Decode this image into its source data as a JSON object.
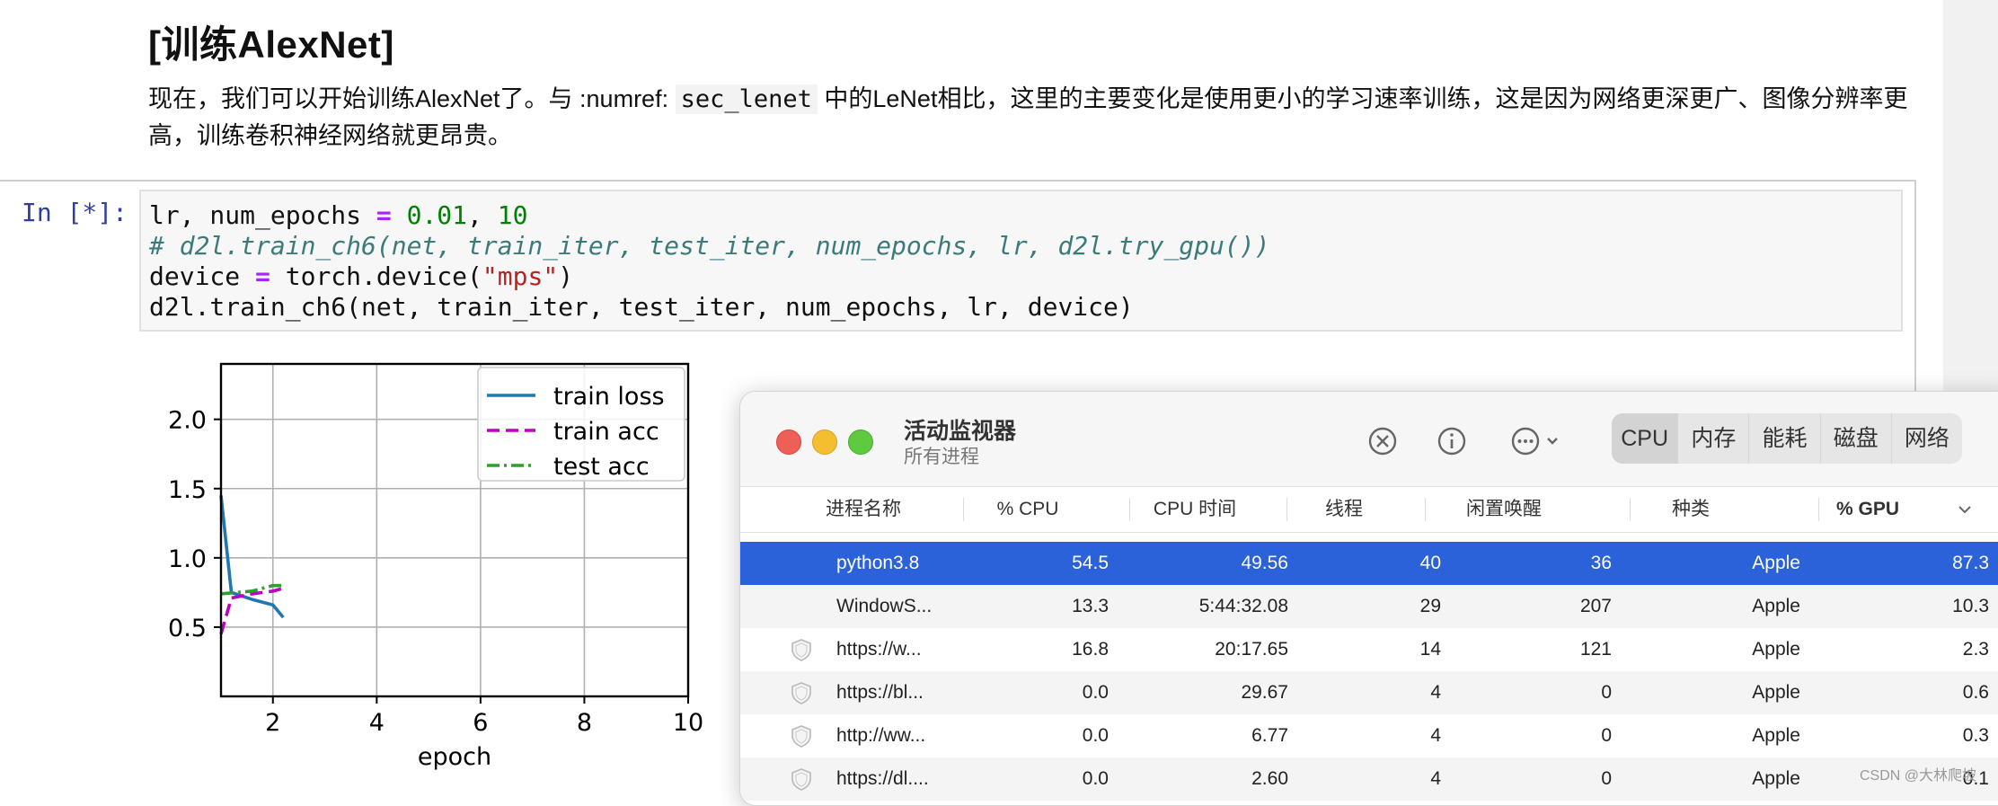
{
  "notebook": {
    "heading": "[训练AlexNet]",
    "para_pre": "现在，我们可以开始训练AlexNet了。与 :numref: ",
    "para_code": "sec_lenet",
    "para_post": " 中的LeNet相比，这里的主要变化是使用更小的学习速率训练，这是因为网络更深更广、图像分辨率更高，训练卷积神经网络就更昂贵。",
    "prompt": "In [*]:",
    "code": {
      "l1_a": "lr, num_epochs ",
      "l1_op": "=",
      "l1_b": " ",
      "l1_n1": "0.01",
      "l1_c": ", ",
      "l1_n2": "10",
      "l2": "# d2l.train_ch6(net, train_iter, test_iter, num_epochs, lr, d2l.try_gpu())",
      "l3_a": "device ",
      "l3_op": "=",
      "l3_b": " torch.device(",
      "l3_str": "\"mps\"",
      "l3_c": ")",
      "l4": "d2l.train_ch6(net, train_iter, test_iter, num_epochs, lr, device)"
    }
  },
  "chart_data": {
    "type": "line",
    "xlabel": "epoch",
    "ylabel": "",
    "xlim": [
      1,
      10
    ],
    "ylim": [
      0,
      2.4
    ],
    "xticks": [
      2,
      4,
      6,
      8,
      10
    ],
    "yticks": [
      0.5,
      1.0,
      1.5,
      2.0
    ],
    "ytick_labels": [
      "0.5",
      "1.0",
      "1.5",
      "2.0"
    ],
    "grid": true,
    "legend": "top-right",
    "series": [
      {
        "name": "train loss",
        "color": "#1f77b4",
        "dash": "solid",
        "x": [
          1.0,
          1.2,
          1.6,
          2.0,
          2.2
        ],
        "y": [
          1.45,
          0.75,
          0.7,
          0.66,
          0.57
        ]
      },
      {
        "name": "train acc",
        "color": "#bf00bf",
        "dash": "dashed",
        "x": [
          1.0,
          1.2,
          1.6,
          2.0,
          2.2
        ],
        "y": [
          0.45,
          0.71,
          0.74,
          0.76,
          0.78
        ]
      },
      {
        "name": "test acc",
        "color": "#2ca02c",
        "dash": "dashdot",
        "x": [
          1.0,
          1.6,
          2.0,
          2.2
        ],
        "y": [
          0.74,
          0.76,
          0.8,
          0.8
        ]
      }
    ]
  },
  "activity_monitor": {
    "title": "活动监视器",
    "subtitle": "所有进程",
    "tabs": [
      "CPU",
      "内存",
      "能耗",
      "磁盘",
      "网络"
    ],
    "columns": [
      "进程名称",
      "% CPU",
      "CPU 时间",
      "线程",
      "闲置唤醒",
      "种类",
      "% GPU"
    ],
    "rows": [
      {
        "name": "python3.8",
        "cpu": "54.5",
        "time": "49.56",
        "threads": "40",
        "idle": "36",
        "kind": "Apple",
        "gpu": "87.3"
      },
      {
        "name": "WindowS...",
        "cpu": "13.3",
        "time": "5:44:32.08",
        "threads": "29",
        "idle": "207",
        "kind": "Apple",
        "gpu": "10.3"
      },
      {
        "name": "https://w...",
        "cpu": "16.8",
        "time": "20:17.65",
        "threads": "14",
        "idle": "121",
        "kind": "Apple",
        "gpu": "2.3"
      },
      {
        "name": "https://bl...",
        "cpu": "0.0",
        "time": "29.67",
        "threads": "4",
        "idle": "0",
        "kind": "Apple",
        "gpu": "0.6"
      },
      {
        "name": "http://ww...",
        "cpu": "0.0",
        "time": "6.77",
        "threads": "4",
        "idle": "0",
        "kind": "Apple",
        "gpu": "0.3"
      },
      {
        "name": "https://dl....",
        "cpu": "0.0",
        "time": "2.60",
        "threads": "4",
        "idle": "0",
        "kind": "Apple",
        "gpu": "0.1"
      }
    ]
  },
  "watermark": "CSDN @大林爬坡"
}
